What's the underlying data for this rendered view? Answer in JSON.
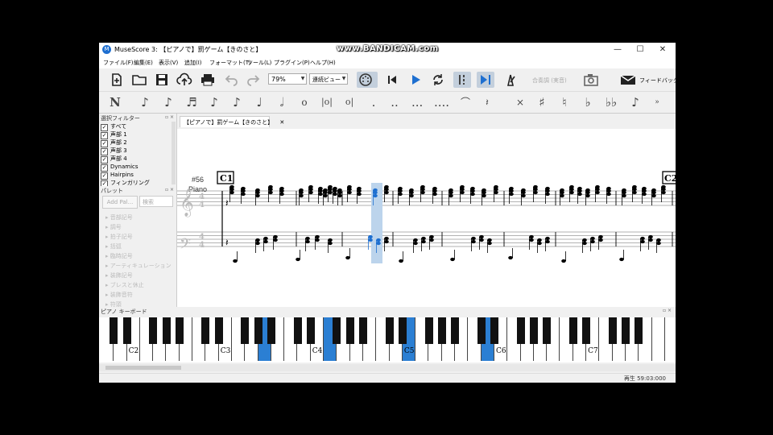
{
  "watermark": "www.BANDICAM.com",
  "window": {
    "title": "MuseScore 3: 【ピアノで】罰ゲーム【きのさと】",
    "icon": "musescore-icon",
    "controls": [
      "—",
      "☐",
      "✕"
    ]
  },
  "menu": [
    "ファイル(F)",
    "編集(E)",
    "表示(V)",
    "追加(I)",
    "フォーマット(T)",
    "ツール(L)",
    "プラグイン(P)",
    "ヘルプ(H)"
  ],
  "toolbar": {
    "zoom": "79%",
    "view_mode": "連続ビュー",
    "concert_pitch": "合奏調 (実音)",
    "feedback": "フィードバック",
    "icons": [
      "new-file-icon",
      "open-folder-icon",
      "save-icon",
      "cloud-upload-icon",
      "print-icon",
      "undo-icon",
      "redo-icon",
      "midi-input-icon",
      "rewind-icon",
      "play-icon",
      "loop-icon",
      "loop-in-icon",
      "loop-out-icon",
      "metronome-icon",
      "screenshot-icon",
      "feedback-icon"
    ],
    "accent_color": "#1e6fd0"
  },
  "note_input": {
    "icons": [
      "note-input-mode-icon",
      "note-64th-icon",
      "note-32nd-icon",
      "note-16th-icon",
      "note-eighth-icon",
      "note-quarter-icon",
      "note-half-icon",
      "note-whole-icon",
      "note-breve-icon",
      "note-longa-icon",
      "augmentation-dot-icon",
      "double-dot-icon",
      "tie-icon",
      "rest-icon",
      "flip-icon",
      "toggle-sharp-icon",
      "toggle-natural-icon",
      "toggle-flat-icon",
      "double-sharp-icon",
      "double-flat-icon",
      "voice-icon",
      "more-icon"
    ]
  },
  "selection_filter": {
    "title": "選択フィルター",
    "items": [
      "すべて",
      "声部 1",
      "声部 2",
      "声部 3",
      "声部 4",
      "Dynamics",
      "Hairpins",
      "フィンガリング"
    ]
  },
  "palette": {
    "title": "パレット",
    "add_label": "Add Pal...",
    "search_placeholder": "検索",
    "items": [
      "音部記号",
      "調号",
      "拍子記号",
      "括弧",
      "臨時記号",
      "アーティキュレーション",
      "装飾記号",
      "ブレスと休止",
      "装飾音符",
      "符頭"
    ]
  },
  "score": {
    "tab_title": "【ピアノで】罰ゲーム【きのさと】",
    "close_tab": "✕",
    "rehearsal_marks": [
      "C1",
      "C2"
    ],
    "measure_number": "#56",
    "instrument": "Piano",
    "time_signature": [
      "4",
      "4"
    ]
  },
  "piano_keyboard": {
    "title": "ピアノ キーボード",
    "octave_labels": [
      "C2",
      "C3",
      "C4",
      "C5",
      "C6",
      "C7"
    ],
    "highlight_color": "#2b7fd3"
  },
  "status": {
    "text": "再生   59:03:000"
  }
}
